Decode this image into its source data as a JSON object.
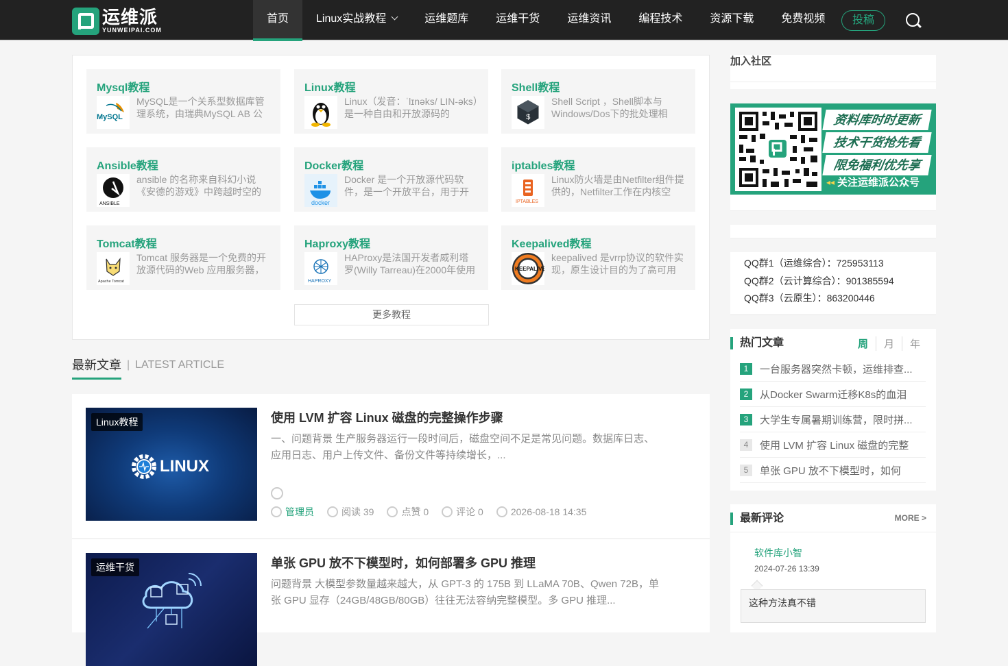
{
  "brand": {
    "name_cn": "运维派",
    "name_en": "YUNWEIPAI.COM"
  },
  "nav": {
    "items": [
      {
        "label": "首页",
        "active": true
      },
      {
        "label": "Linux实战教程",
        "dropdown": true
      },
      {
        "label": "运维题库"
      },
      {
        "label": "运维干货"
      },
      {
        "label": "运维资讯"
      },
      {
        "label": "编程技术"
      },
      {
        "label": "资源下载"
      },
      {
        "label": "免费视频"
      }
    ],
    "submit_label": "投稿"
  },
  "tutorials": {
    "items": [
      {
        "title": "Mysql教程",
        "desc": "MySQL是一个关系型数据库管理系统，由瑞典MySQL AB 公",
        "icon": "mysql-logo-icon"
      },
      {
        "title": "Linux教程",
        "desc": "Linux（发音：ˈlɪnəks/ LIN-əks）是一种自由和开放源码的",
        "icon": "tux-penguin-icon"
      },
      {
        "title": "Shell教程",
        "desc": "Shell Script ，Shell脚本与Windows/Dos下的批处理相",
        "icon": "shell-terminal-icon"
      },
      {
        "title": "Ansible教程",
        "desc": "ansible 的名称来自科幻小说《安德的游戏》中跨越时空的",
        "icon": "ansible-logo-icon"
      },
      {
        "title": "Docker教程",
        "desc": "Docker 是一个开放源代码软件，是一个开放平台，用于开",
        "icon": "docker-whale-icon"
      },
      {
        "title": "iptables教程",
        "desc": "Linux防火墙是由Netfilter组件提供的，Netfilter工作在内核空",
        "icon": "iptables-firewall-icon"
      },
      {
        "title": "Tomcat教程",
        "desc": "Tomcat 服务器是一个免费的开放源代码的Web 应用服务器，",
        "icon": "tomcat-cat-icon"
      },
      {
        "title": "Haproxy教程",
        "desc": "HAProxy是法国开发者威利塔罗(Willy Tarreau)在2000年使用",
        "icon": "haproxy-logo-icon"
      },
      {
        "title": "Keepalived教程",
        "desc": "keepalived 是vrrp协议的软件实现，原生设计目的为了高可用",
        "icon": "keepalived-logo-icon"
      }
    ],
    "more_label": "更多教程",
    "logo_texts": {
      "mysql": "MySQL",
      "ansible": "ANSIBLE",
      "docker": "docker",
      "iptables": "IPTABLES",
      "tomcat": "Apache Tomcat",
      "haproxy": "HAPROXY",
      "keepalived": "KEEPALIVED"
    }
  },
  "latest": {
    "title_cn": "最新文章",
    "separator": "|",
    "title_en": "LATEST ARTICLE"
  },
  "articles": [
    {
      "category": "Linux教程",
      "title": "使用 LVM 扩容 Linux 磁盘的完整操作步骤",
      "excerpt": "一、问题背景 生产服务器运行一段时间后，磁盘空间不足是常见问题。数据库日志、应用日志、用户上传文件、备份文件等持续增长，...",
      "thumb_text": "LINUX",
      "author": "管理员",
      "views": "阅读 39",
      "likes": "点赞 0",
      "comments": "评论 0",
      "date": "2026-08-18 14:35"
    },
    {
      "category": "运维干货",
      "title": "单张 GPU 放不下模型时，如何部署多 GPU 推理",
      "excerpt": "问题背景 大模型参数量越来越大，从 GPT-3 的 175B 到 LLaMA 70B、Qwen 72B，单张 GPU 显存（24GB/48GB/80GB）往往无法容纳完整模型。多 GPU 推理..."
    }
  ],
  "sidebar": {
    "join_title": "加入社区",
    "qr_slogans": [
      "资料库时时更新",
      "技术干货抢先看",
      "限免福利优先享",
      "关注运维派公众号"
    ],
    "qq_groups": [
      "QQ群1（运维综合）：725953113",
      "QQ群2（云计算综合）：901385594",
      "QQ群3（云原生）：863200446"
    ],
    "hot": {
      "title": "热门文章",
      "tabs": [
        "周",
        "月",
        "年"
      ],
      "items": [
        {
          "rank": "1",
          "text": "一台服务器突然卡顿，运维排查..."
        },
        {
          "rank": "2",
          "text": "从Docker Swarm迁移K8s的血泪"
        },
        {
          "rank": "3",
          "text": "大学生专属暑期训练营，限时拼..."
        },
        {
          "rank": "4",
          "text": "使用 LVM 扩容 Linux 磁盘的完整"
        },
        {
          "rank": "5",
          "text": "单张 GPU 放不下模型时，如何"
        }
      ]
    },
    "comments": {
      "title": "最新评论",
      "more": "MORE >",
      "items": [
        {
          "user": "软件库小智",
          "time": "2024-07-26 13:39",
          "text": "这种方法真不错"
        }
      ]
    }
  },
  "colors": {
    "brand": "#25a37c",
    "topbar": "#222222"
  }
}
